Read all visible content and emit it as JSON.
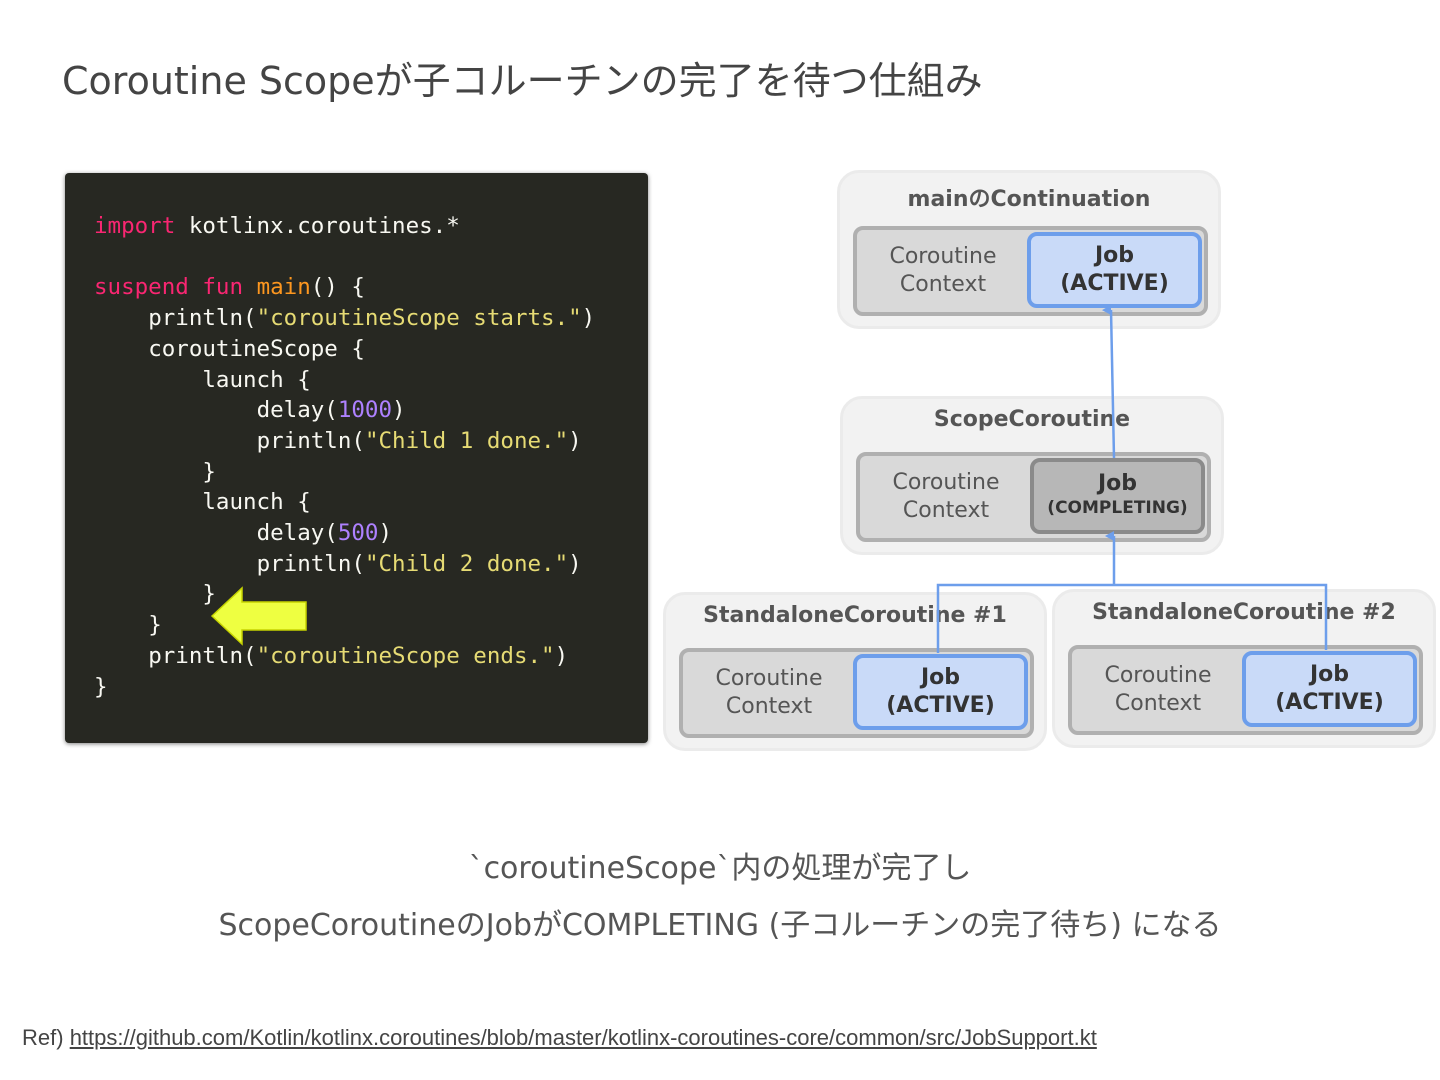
{
  "title": "Coroutine Scopeが子コルーチンの完了を待つ仕組み",
  "code": {
    "line1": {
      "kw": "import",
      "rest": " kotlinx.coroutines.*"
    },
    "line3": {
      "kw1": "suspend",
      "kw2": "fun",
      "fn": "main",
      "rest": "() {"
    },
    "println_open": "println(",
    "close_paren": ")",
    "str_starts": "\"coroutineScope starts.\"",
    "scope_open": "coroutineScope {",
    "launch_open": "launch {",
    "delay_open": "delay(",
    "num_1000": "1000",
    "num_500": "500",
    "str_child1": "\"Child 1 done.\"",
    "str_child2": "\"Child 2 done.\"",
    "brace_close": "}",
    "str_ends": "\"coroutineScope ends.\""
  },
  "diagram": {
    "main_box": {
      "title": "mainのContinuation",
      "context_line1": "Coroutine",
      "context_line2": "Context",
      "job_line1": "Job",
      "job_line2": "(ACTIVE)"
    },
    "scope_box": {
      "title": "ScopeCoroutine",
      "context_line1": "Coroutine",
      "context_line2": "Context",
      "job_line1": "Job",
      "job_line2": "(COMPLETING)"
    },
    "child1_box": {
      "title": "StandaloneCoroutine #1",
      "context_line1": "Coroutine",
      "context_line2": "Context",
      "job_line1": "Job",
      "job_line2": "(ACTIVE)"
    },
    "child2_box": {
      "title": "StandaloneCoroutine #2",
      "context_line1": "Coroutine",
      "context_line2": "Context",
      "job_line1": "Job",
      "job_line2": "(ACTIVE)"
    }
  },
  "caption": {
    "line1": "`coroutineScope`内の処理が完了し",
    "line2": "ScopeCoroutineのJobがCOMPLETING (子コルーチンの完了待ち) になる"
  },
  "reference": {
    "label": "Ref) ",
    "url": "https://github.com/Kotlin/kotlinx.coroutines/blob/master/kotlinx-coroutines-core/common/src/JobSupport.kt"
  },
  "colors": {
    "code_bg": "#272822",
    "keyword": "#f92672",
    "function": "#fd971f",
    "string": "#e6db74",
    "number": "#ae81ff",
    "job_active": "#c9daf8",
    "job_active_border": "#6d9eeb",
    "job_completing": "#b7b7b7",
    "indicator_arrow": "#eeff41"
  }
}
